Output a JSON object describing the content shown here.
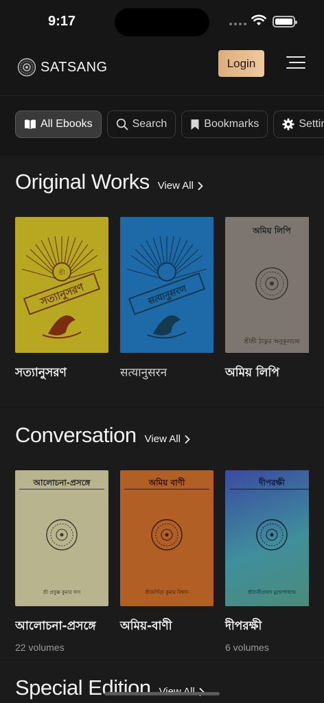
{
  "status": {
    "time": "9:17"
  },
  "header": {
    "brand": "SATSANG",
    "login_label": "Login"
  },
  "chips": [
    {
      "label": "All Ebooks",
      "icon": "book-open-icon",
      "active": true
    },
    {
      "label": "Search",
      "icon": "search-icon",
      "active": false
    },
    {
      "label": "Bookmarks",
      "icon": "bookmark-icon",
      "active": false
    },
    {
      "label": "Settings",
      "icon": "gear-icon",
      "active": false
    }
  ],
  "sections": [
    {
      "title": "Original Works",
      "view_all": "View All",
      "books": [
        {
          "title": "সত্যানুসরণ",
          "cover_text": "সত্যানুসরণ",
          "cover_color": "#b8a821"
        },
        {
          "title": "सत्यानुसरन",
          "cover_text": "सत्यानुसरण",
          "cover_color": "#1e6aa8"
        },
        {
          "title": "অমিয় লিপি",
          "cover_top": "অমিয় লিপি",
          "cover_bottom": "শ্রীশ্রী ঠাকুর অনুকূলচন্দ্র",
          "cover_color": "#7d7670"
        }
      ]
    },
    {
      "title": "Conversation",
      "view_all": "View All",
      "books": [
        {
          "title": "আলোচনা-প্রসঙ্গে",
          "subtitle": "22 volumes",
          "cover_top": "আলোচনা-প্রসঙ্গে",
          "cover_bottom": "শ্রী প্রফুল্ল কুমার দাস",
          "cover_color": "#b8b48e"
        },
        {
          "title": "অমিয়-বাণী",
          "cover_top": "অমিয় বাণী",
          "cover_bottom": "শ্রীঅর্পিতা কুমার বিশ্বাস",
          "cover_color": "#b25f25"
        },
        {
          "title": "দীপরক্ষী",
          "subtitle": "6 volumes",
          "cover_top": "দীপরক্ষী",
          "cover_bottom": "শ্রীদেবীপ্রসাদ মুখোপাধ্যায়",
          "cover_color": "#3f8f9c"
        }
      ]
    },
    {
      "title": "Special Edition",
      "view_all": "View All"
    }
  ]
}
